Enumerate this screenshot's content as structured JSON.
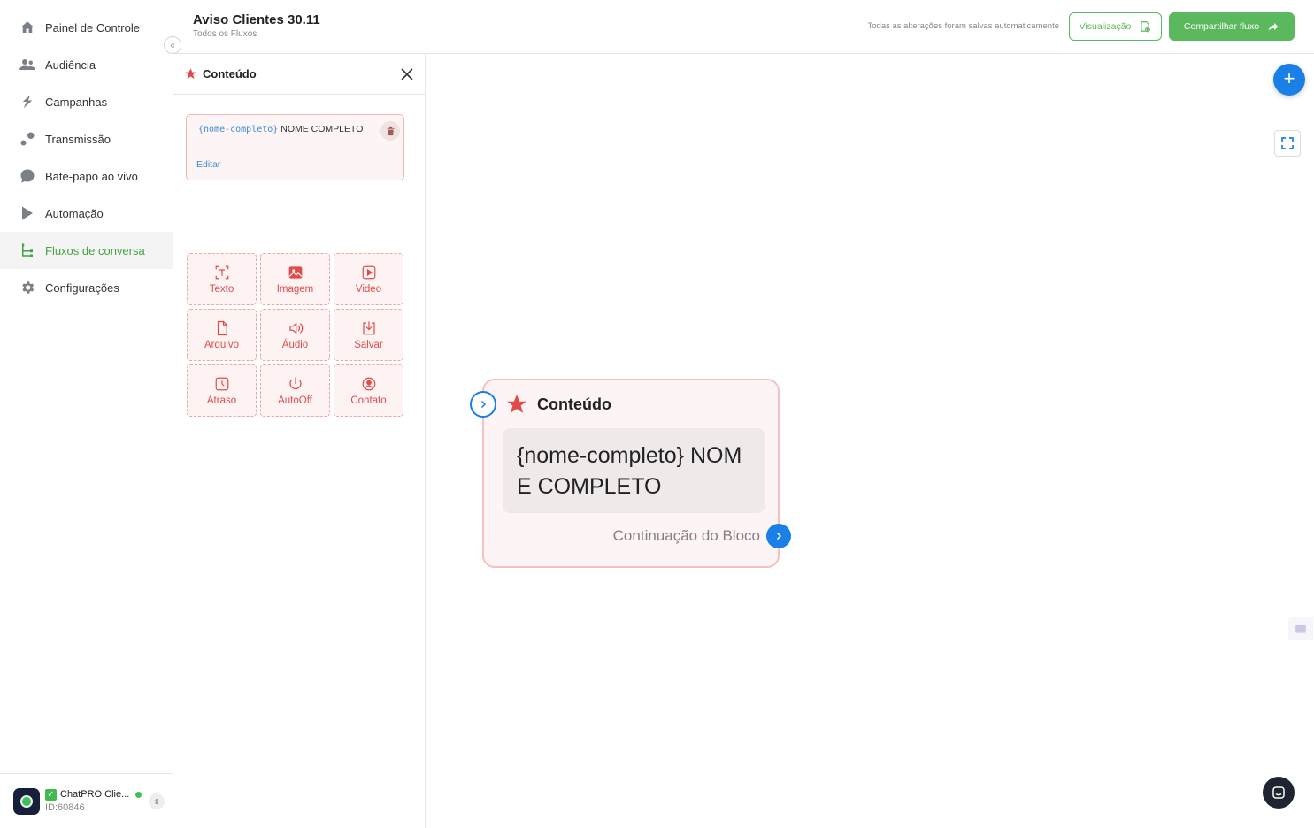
{
  "sidebar": {
    "items": [
      {
        "label": "Painel de Controle",
        "icon": "home-icon"
      },
      {
        "label": "Audiência",
        "icon": "users-icon"
      },
      {
        "label": "Campanhas",
        "icon": "campaign-icon"
      },
      {
        "label": "Transmissão",
        "icon": "broadcast-icon"
      },
      {
        "label": "Bate-papo ao vivo",
        "icon": "chat-icon"
      },
      {
        "label": "Automação",
        "icon": "automation-icon"
      },
      {
        "label": "Fluxos de conversa",
        "icon": "flow-icon",
        "active": true
      },
      {
        "label": "Configurações",
        "icon": "gear-icon"
      }
    ],
    "account": {
      "name": "ChatPRO Clie...",
      "id": "ID:60846"
    }
  },
  "header": {
    "title": "Aviso Clientes 30.11",
    "breadcrumb": "Todos os Fluxos",
    "autosave": "Todas as alterações foram salvas automaticamente",
    "preview_label": "Visualização",
    "share_label": "Compartilhar fluxo"
  },
  "panel": {
    "title": "Conteúdo",
    "message": {
      "variable": "{nome-completo}",
      "text": "NOME COMPLETO",
      "edit_label": "Editar"
    },
    "tools": [
      {
        "label": "Texto",
        "icon": "text-icon"
      },
      {
        "label": "Imagem",
        "icon": "image-icon"
      },
      {
        "label": "Video",
        "icon": "video-icon"
      },
      {
        "label": "Arquivo",
        "icon": "file-icon"
      },
      {
        "label": "Áudio",
        "icon": "audio-icon"
      },
      {
        "label": "Salvar",
        "icon": "save-icon"
      },
      {
        "label": "Atraso",
        "icon": "delay-icon"
      },
      {
        "label": "AutoOff",
        "icon": "power-icon"
      },
      {
        "label": "Contato",
        "icon": "contact-icon"
      }
    ]
  },
  "node": {
    "title": "Conteúdo",
    "body": "{nome-completo} NOME COMPLETO",
    "continuation": "Continuação do Bloco"
  },
  "colors": {
    "accent_green": "#5cb85c",
    "accent_blue": "#1a7fe6",
    "accent_red": "#e04b4b"
  }
}
